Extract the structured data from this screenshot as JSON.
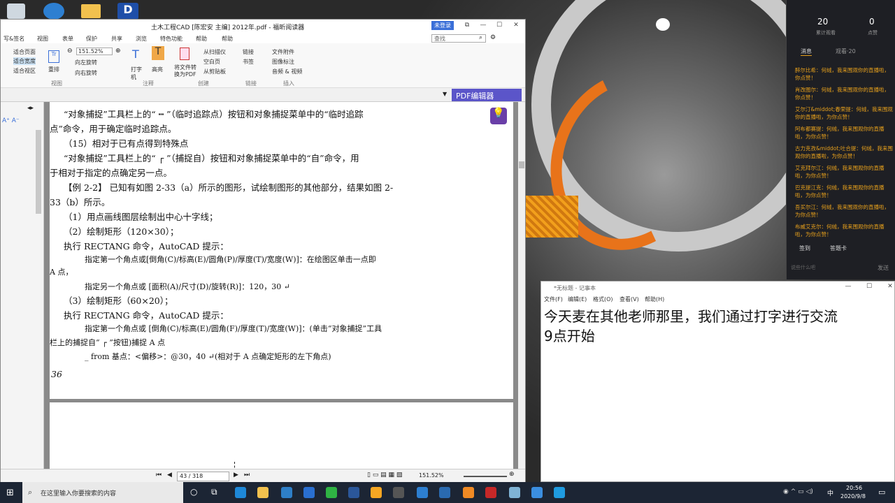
{
  "pdf_window": {
    "title": "土木工程CAD [陈宏安 主编] 2012年.pdf - 福昕阅读器",
    "login": "未登录",
    "search_placeholder": "查找",
    "menus": [
      "写&签名",
      "视图",
      "表单",
      "保护",
      "共享",
      "浏览",
      "特色功能",
      "帮助",
      "帮助"
    ],
    "ribbon": {
      "fit_page": "适合页面",
      "fit_width": "适合宽度",
      "fit_view": "适合视区",
      "zoom": "151.52%",
      "rotate_left": "向左旋转",
      "rotate_right": "向右旋转",
      "reflow": "重排",
      "typewriter": "打字机",
      "highlight": "高亮",
      "convert": "将文件转换为PDF",
      "from_scanner": "从扫描仪",
      "blank_page": "空白页",
      "from_clipboard": "从剪贴板",
      "link": "链接",
      "bookmark": "书签",
      "file_attachment": "文件附件",
      "image_annotation": "图像标注",
      "audio_video": "音频 & 视频",
      "group_view": "视图",
      "group_comment": "注释",
      "group_create": "创建",
      "group_link": "链接",
      "group_insert": "插入"
    },
    "pdf_editor_button": "PDF编辑器",
    "page_lines": [
      "“对象捕捉”工具栏上的“ ┅ ”（临时追踪点）按钮和对象捕捉菜单中的“临时追踪",
      "点”命令，用于确定临时追踪点。",
      "（15）相对于已有点得到特殊点",
      "“对象捕捉”工具栏上的“ ┌ ”（捕捉自）按钮和对象捕捉菜单中的“自”命令，用",
      "于相对于指定的点确定另一点。",
      "【例 2-2】 已知有如图 2-33（a）所示的图形，试绘制图形的其他部分，结果如图 2-",
      "33（b）所示。",
      "（1）用点画线图层绘制出中心十字线；",
      "（2）绘制矩形（120×30）；",
      "执行 RECTANG 命令，AutoCAD 提示：",
      "指定第一个角点或[倒角(C)/标高(E)/圆角(P)/厚度(T)/宽度(W)]：在绘图区单击一点即",
      "A 点，",
      "指定另一个角点或 [面积(A)/尺寸(D)/旋转(R)]：120，30 ↵",
      "（3）绘制矩形（60×20）；",
      "执行 RECTANG 命令，AutoCAD 提示：",
      "指定第一个角点或 [倒角(C)/标高(E)/圆角(F)/厚度(T)/宽度(W)]：(单击“对象捕捉”工具",
      "栏上的捕捉自“ ┌ ”按钮)捕捉 A 点",
      "_ from 基点：<偏移>：@30，40 ↵(相对于 A 点确定矩形的左下角点)"
    ],
    "page_number_printed": "36",
    "page_nav": "43 / 318",
    "zoom_status": "151.52%"
  },
  "chat": {
    "viewers_count": "20",
    "viewers_label": "累计观看",
    "likes_count": "0",
    "likes_label": "点赞",
    "tab_messages": "消息",
    "tab_viewers": "观看·20",
    "messages": [
      "醉尔比希：何绒，我来围观你的直播啦，你点赞！",
      "肖改图尔：何绒，我来围观你的直播啦，你点赞！",
      "艾尔汀&middot;春荣提：何绒，我来围观你的直播啦，为你点赞！",
      "阿布都赛提：何绒，我来围观你的直播啦，为你点赞！",
      "古力克孜&middot;吐合提：何绒，我来围观你的直播啦，为你点赞！",
      "艾克拜尔江：何绒，我来围观你的直播啦，为你点赞！",
      "巴克提江克：何绒，我来围观你的直播啦，为你点赞！",
      "吾买尔江：何绒，我来围观你的直播啦，为你点赞！",
      "布威艾克尔：何绒，我来围观你的直播啦，为你点赞！"
    ],
    "sign_in": "签到",
    "answer_card": "答题卡",
    "input_placeholder": "说些什么吧",
    "send": "发送"
  },
  "notepad": {
    "title": "*无标题 - 记事本",
    "menus": [
      "文件(F)",
      "编辑(E)",
      "格式(O)",
      "查看(V)",
      "帮助(H)"
    ],
    "content": "今天麦在其他老师那里，我们通过打字进行交流\n9点开始"
  },
  "taskbar": {
    "search_placeholder": "在这里输入你要搜索的内容",
    "time": "20:56",
    "date": "2020/9/8",
    "ime": "中"
  }
}
